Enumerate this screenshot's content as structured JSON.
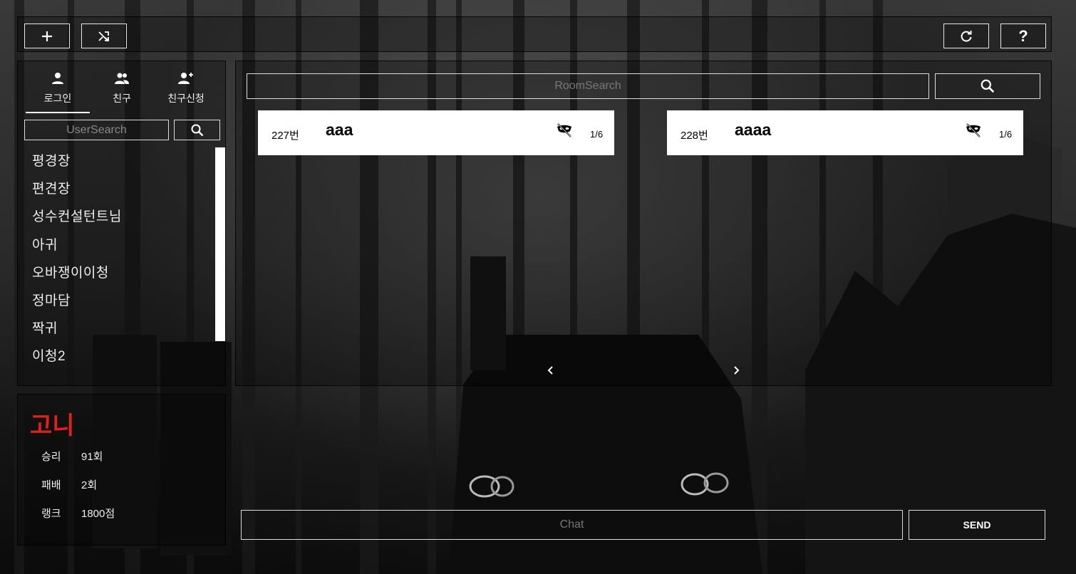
{
  "toolbar": {
    "create_room_icon": "plus-icon",
    "random_join_icon": "shuffle-icon",
    "refresh_icon": "refresh-icon",
    "help_label": "?"
  },
  "tabs": [
    {
      "label": "로그인",
      "icon": "person-icon"
    },
    {
      "label": "친구",
      "icon": "people-icon"
    },
    {
      "label": "친구신청",
      "icon": "person-add-icon"
    }
  ],
  "user_search": {
    "placeholder": "UserSearch"
  },
  "friends": [
    "평경장",
    "편견장",
    "성수컨설턴트님",
    "아귀",
    "오바쟁이이청",
    "정마담",
    "짝귀",
    "이청2"
  ],
  "profile": {
    "name": "고니",
    "stats": [
      {
        "label": "승리",
        "value": "91회"
      },
      {
        "label": "패배",
        "value": "2회"
      },
      {
        "label": "랭크",
        "value": "1800점"
      }
    ]
  },
  "room_search": {
    "placeholder": "RoomSearch"
  },
  "rooms": [
    {
      "number": "227번",
      "title": "aaa",
      "count": "1/6",
      "icon": "private-lock-icon"
    },
    {
      "number": "228번",
      "title": "aaaa",
      "count": "1/6",
      "icon": "private-lock-icon"
    }
  ],
  "chat": {
    "placeholder": "Chat",
    "send_label": "SEND"
  }
}
